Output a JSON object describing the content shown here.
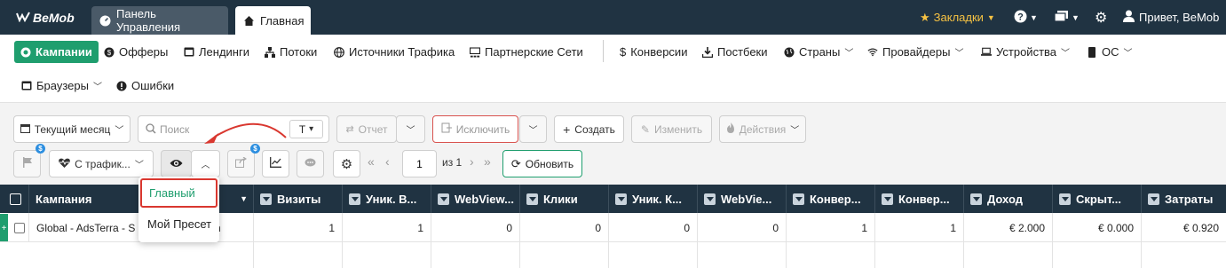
{
  "brand": "BeMob",
  "colors": {
    "topbar": "#203342",
    "accent": "#1f9e6e",
    "bookmarks": "#f6c243",
    "badge": "#2d8fe0",
    "highlight": "#d9372f"
  },
  "topbar": {
    "tabs": [
      {
        "label": "Панель Управления",
        "icon": "dashboard-icon"
      },
      {
        "label": "Главная",
        "icon": "home-icon"
      }
    ],
    "bookmarks": "Закладки",
    "greeting": "Привет, BeMob"
  },
  "nav": {
    "items": [
      {
        "label": "Кампании",
        "icon": "campaign-icon",
        "active": true
      },
      {
        "label": "Офферы",
        "icon": "dollar-circle-icon"
      },
      {
        "label": "Лендинги",
        "icon": "window-icon"
      },
      {
        "label": "Потоки",
        "icon": "flows-icon"
      },
      {
        "label": "Источники Трафика",
        "icon": "globe-icon"
      },
      {
        "label": "Партнерские Сети",
        "icon": "network-icon"
      },
      {
        "label": "Конверсии",
        "icon": "dollar-icon"
      },
      {
        "label": "Постбеки",
        "icon": "download-icon"
      },
      {
        "label": "Страны",
        "icon": "globe-icon"
      },
      {
        "label": "Провайдеры",
        "icon": "wifi-icon"
      },
      {
        "label": "Устройства",
        "icon": "laptop-icon"
      },
      {
        "label": "ОС",
        "icon": "phone-icon"
      },
      {
        "label": "Браузеры",
        "icon": "window-icon"
      },
      {
        "label": "Ошибки",
        "icon": "exclamation-icon"
      }
    ]
  },
  "toolbar": {
    "period": "Текущий месяц",
    "search_placeholder": "Поиск",
    "search_type": "T",
    "report": "Отчет",
    "exclude": "Исключить",
    "create": "Создать",
    "edit": "Изменить",
    "actions": "Действия",
    "traffic_filter": "С трафик...",
    "page": "1",
    "of_pages": "из 1",
    "refresh": "Обновить",
    "badge_count": "$"
  },
  "presets_dropdown": {
    "items": [
      "Главный",
      "Мой Пресет"
    ],
    "selected": "Главный"
  },
  "table": {
    "columns": [
      "Кампания",
      "Визиты",
      "Уник. В...",
      "WebView...",
      "Клики",
      "Уник. К...",
      "WebVie...",
      "Конвер...",
      "Конвер...",
      "Доход",
      "Скрыт...",
      "Затраты"
    ],
    "rows": [
      {
        "campaign": "Global - AdsTerra - S",
        "campaign_tail": "n",
        "values": [
          "1",
          "1",
          "0",
          "0",
          "0",
          "0",
          "1",
          "1",
          "€ 2.000",
          "€ 0.000",
          "€ 0.920"
        ]
      }
    ]
  }
}
